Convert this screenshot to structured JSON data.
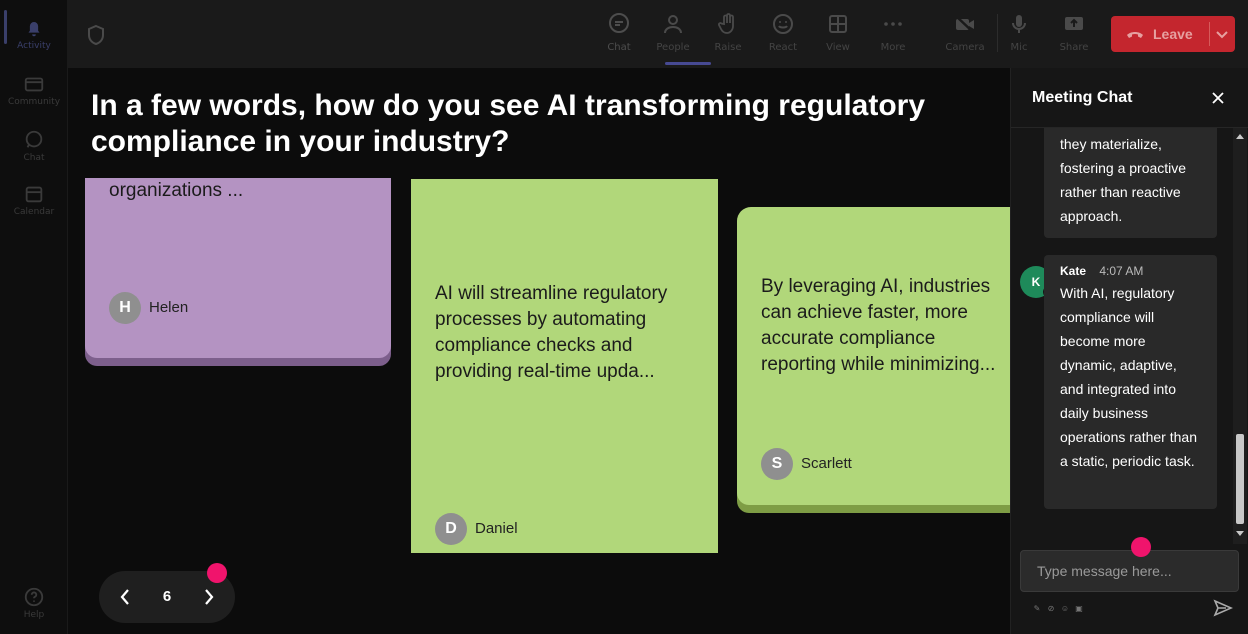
{
  "rail": {
    "items": [
      {
        "label": "Activity",
        "icon": "bell-icon"
      },
      {
        "label": "Community",
        "icon": "community-icon"
      },
      {
        "label": "Chat",
        "icon": "chat-icon"
      },
      {
        "label": "Calendar",
        "icon": "calendar-icon"
      },
      {
        "label": "Help",
        "icon": "help-icon"
      }
    ]
  },
  "toolbar": {
    "buttons": [
      {
        "label": "Chat",
        "icon": "chat-icon"
      },
      {
        "label": "People",
        "icon": "people-icon"
      },
      {
        "label": "Raise",
        "icon": "hand-icon"
      },
      {
        "label": "React",
        "icon": "smiley-icon"
      },
      {
        "label": "View",
        "icon": "grid-icon"
      },
      {
        "label": "More",
        "icon": "more-icon"
      },
      {
        "label": "Camera",
        "icon": "camera-off-icon"
      },
      {
        "label": "Mic",
        "icon": "mic-icon"
      },
      {
        "label": "Share",
        "icon": "share-icon"
      }
    ],
    "leave_label": "Leave",
    "leave_color": "#c4262e",
    "active_tab_color": "#5b5fc7"
  },
  "board": {
    "question": "In a few words, how do you see AI transforming regulatory compliance in your industry?",
    "cards": [
      {
        "text": "organizations ...",
        "author": "Helen",
        "initial": "H",
        "color": "#b493c2"
      },
      {
        "text": "AI will streamline regulatory processes by automating compliance checks and providing real-time upda...",
        "author": "Daniel",
        "initial": "D",
        "color": "#b1d77a"
      },
      {
        "text": "By leveraging AI, industries can achieve faster, more accurate compliance reporting while minimizing...",
        "author": "Scarlett",
        "initial": "S",
        "color": "#b1d77a"
      }
    ],
    "page": "6",
    "highlight_color": "#f0146c"
  },
  "chat": {
    "title": "Meeting Chat",
    "messages": [
      {
        "text": "they materialize, fostering a proactive rather than reactive approach."
      },
      {
        "author": "Kate",
        "initial": "K",
        "time": "4:07 AM",
        "text": "With AI, regulatory compliance will become more dynamic, adaptive, and integrated into daily business operations rather than a static, periodic task.",
        "avatar_color": "#1e8a5a"
      }
    ],
    "input_placeholder": "Type message here..."
  }
}
